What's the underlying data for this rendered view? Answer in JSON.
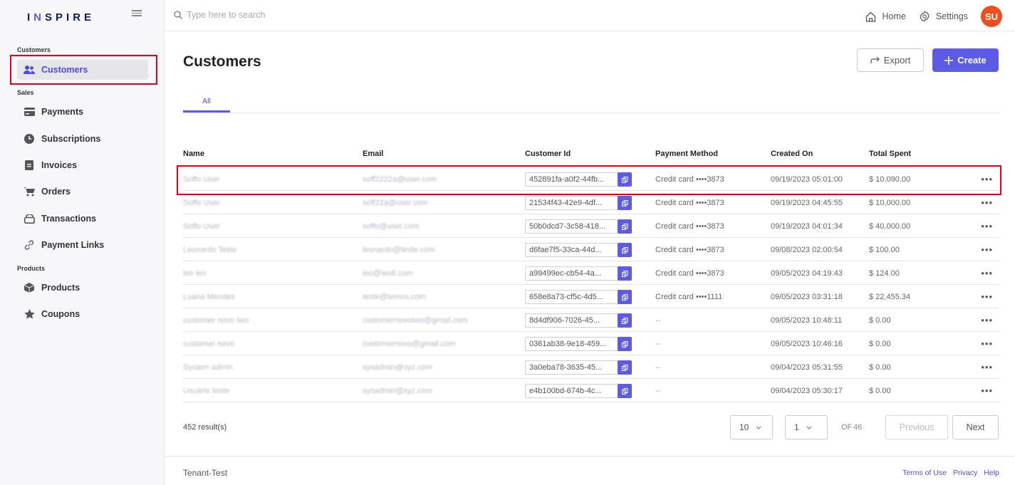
{
  "brand": {
    "logo_text_1": "I",
    "logo_text_n": "N",
    "logo_text_2": "SPIRE"
  },
  "search": {
    "placeholder": "Type here to search"
  },
  "topbar": {
    "home": "Home",
    "settings": "Settings",
    "avatar": "SU"
  },
  "sidebar": {
    "sections": {
      "customers": "Customers",
      "sales": "Sales",
      "products": "Products"
    },
    "items": [
      {
        "label": "Customers",
        "icon": "users-icon",
        "active": true
      },
      {
        "label": "Payments",
        "icon": "card-icon"
      },
      {
        "label": "Subscriptions",
        "icon": "clock-icon"
      },
      {
        "label": "Invoices",
        "icon": "invoice-icon"
      },
      {
        "label": "Orders",
        "icon": "cart-icon"
      },
      {
        "label": "Transactions",
        "icon": "wallet-icon"
      },
      {
        "label": "Payment Links",
        "icon": "link-icon"
      },
      {
        "label": "Products",
        "icon": "box-icon"
      },
      {
        "label": "Coupons",
        "icon": "star-icon"
      }
    ]
  },
  "page": {
    "title": "Customers",
    "export_label": "Export",
    "create_label": "Create",
    "tab_all": "All"
  },
  "table": {
    "headers": {
      "name": "Name",
      "email": "Email",
      "customer_id": "Customer Id",
      "payment_method": "Payment Method",
      "created_on": "Created On",
      "total_spent": "Total Spent"
    },
    "rows": [
      {
        "name": "Soffo User",
        "email": "soff2222a@user.com",
        "id": "452891fa-a0f2-44fb...",
        "pm": "Credit card ••••3873",
        "created": "09/19/2023 05:01:00",
        "total": "$ 10,090.00"
      },
      {
        "name": "Soffo User",
        "email": "soff22a@user.com",
        "id": "21534f43-42e9-4df...",
        "pm": "Credit card ••••3873",
        "created": "09/19/2023 04:45:55",
        "total": "$ 10,000.00"
      },
      {
        "name": "Soffo User",
        "email": "soffo@user.com",
        "id": "50b0dcd7-3c58-418...",
        "pm": "Credit card ••••3873",
        "created": "09/19/2023 04:01:34",
        "total": "$ 40,000.00"
      },
      {
        "name": "Leonardo Teste",
        "email": "leonardo@teste.com",
        "id": "d6fae7f5-33ca-44d...",
        "pm": "Credit card ••••3873",
        "created": "09/08/2023 02:00:54",
        "total": "$ 100.00"
      },
      {
        "name": "leo leo",
        "email": "leo@leo8.com",
        "id": "a99499ec-cb54-4a...",
        "pm": "Credit card ••••3873",
        "created": "09/05/2023 04:19:43",
        "total": "$ 124.00"
      },
      {
        "name": "Luana Mendes",
        "email": "teste@temns.com",
        "id": "658e8a73-cf5c-4d5...",
        "pm": "Credit card ••••1111",
        "created": "09/05/2023 03:31:18",
        "total": "$ 22,455.34"
      },
      {
        "name": "customer novo two",
        "email": "customernovotwo@gmail.com",
        "id": "8d4df906-7026-45...",
        "pm": "--",
        "created": "09/05/2023 10:48:11",
        "total": "$ 0.00"
      },
      {
        "name": "customer novo",
        "email": "customernovo@gmail.com",
        "id": "0361ab38-9e18-459...",
        "pm": "--",
        "created": "09/05/2023 10:46:16",
        "total": "$ 0.00"
      },
      {
        "name": "System admin",
        "email": "sysadmin@xyz.com",
        "id": "3a0eba78-3635-45...",
        "pm": "--",
        "created": "09/04/2023 05:31:55",
        "total": "$ 0.00"
      },
      {
        "name": "Usuário teste",
        "email": "sysadmin@xyz.com",
        "id": "e4b100bd-674b-4c...",
        "pm": "--",
        "created": "09/04/2023 05:30:17",
        "total": "$ 0.00"
      }
    ]
  },
  "pagination": {
    "results": "452 result(s)",
    "page_size": "10",
    "page": "1",
    "of": "OF",
    "total_pages": "46",
    "previous": "Previous",
    "next": "Next"
  },
  "footer": {
    "tenant": "Tenant-Test",
    "terms": "Terms of Use",
    "privacy": "Privacy",
    "help": "Help"
  },
  "colors": {
    "accent": "#5b5be6",
    "highlight": "#e3001b",
    "avatar": "#f04e1c"
  }
}
